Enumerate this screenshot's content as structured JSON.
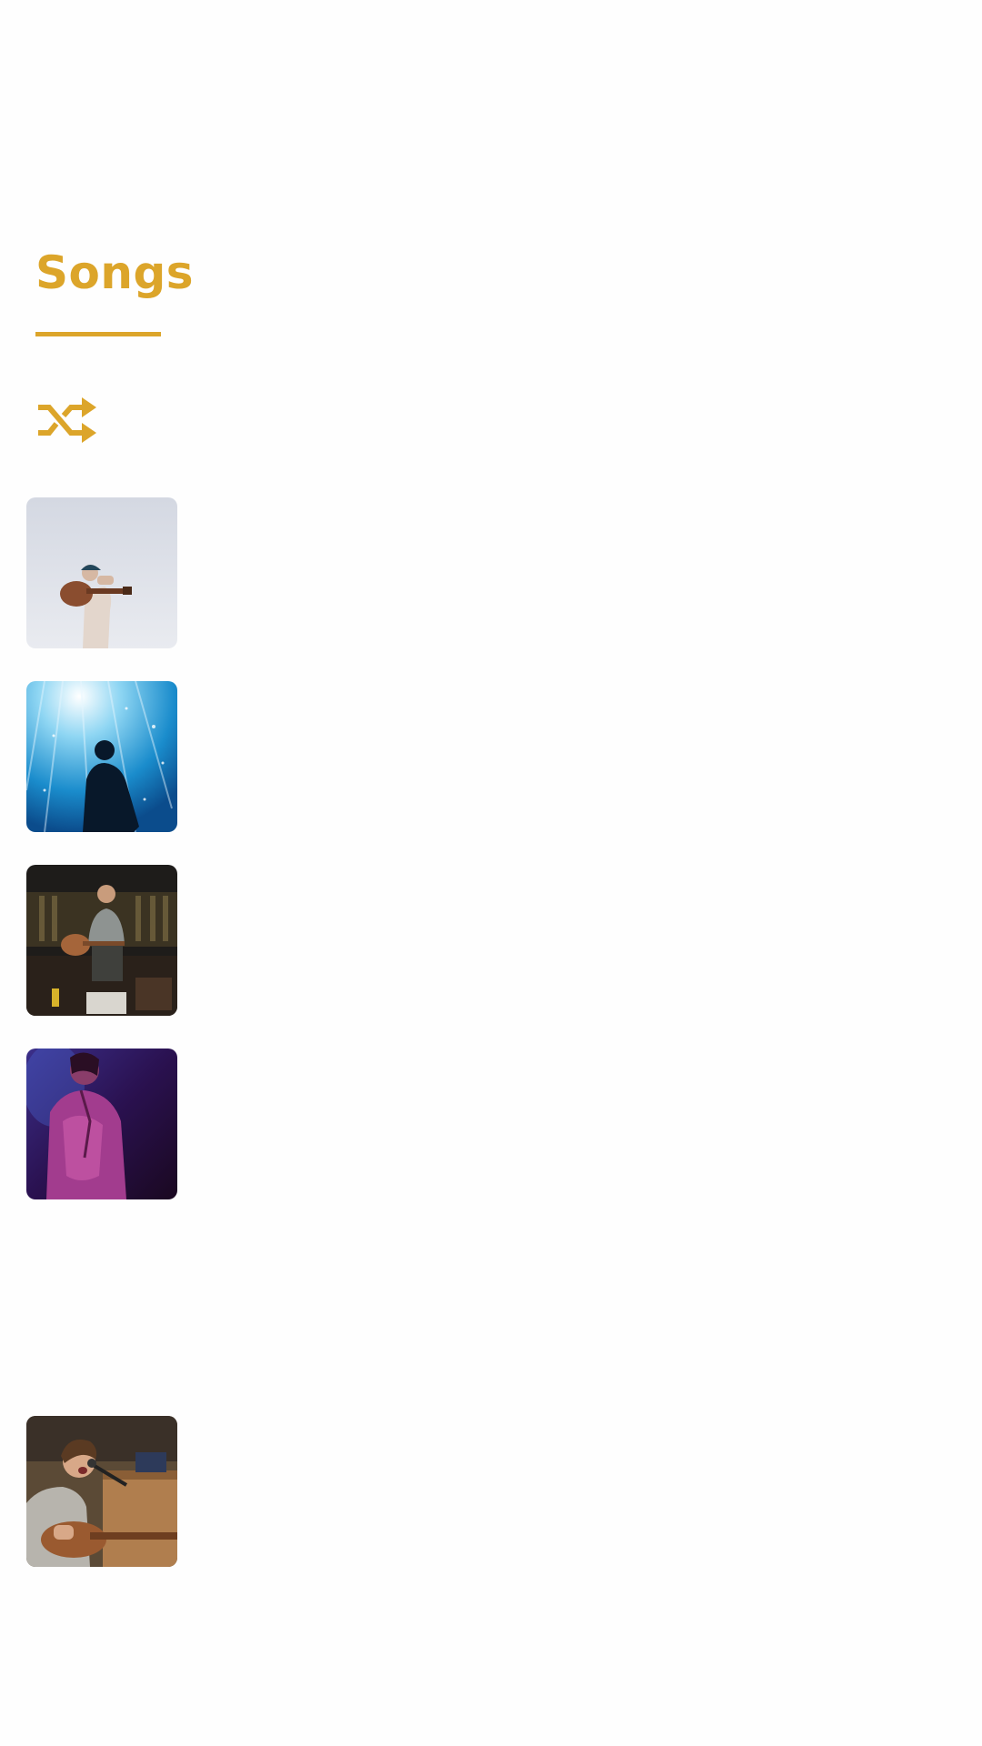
{
  "tabs": {
    "active_label": "Songs"
  },
  "colors": {
    "accent": "#dca52a",
    "background": "#fefefe"
  },
  "controls": {
    "shuffle_icon": "shuffle-icon"
  },
  "songs": [
    {
      "artwork": "man-with-acoustic-guitar-on-shoulder"
    },
    {
      "artwork": "silhouette-in-blue-stage-light"
    },
    {
      "artwork": "guitarist-seated-on-stage"
    },
    {
      "artwork": "woman-in-magenta-light"
    },
    {
      "artwork": "singer-playing-guitar-at-microphone"
    }
  ]
}
